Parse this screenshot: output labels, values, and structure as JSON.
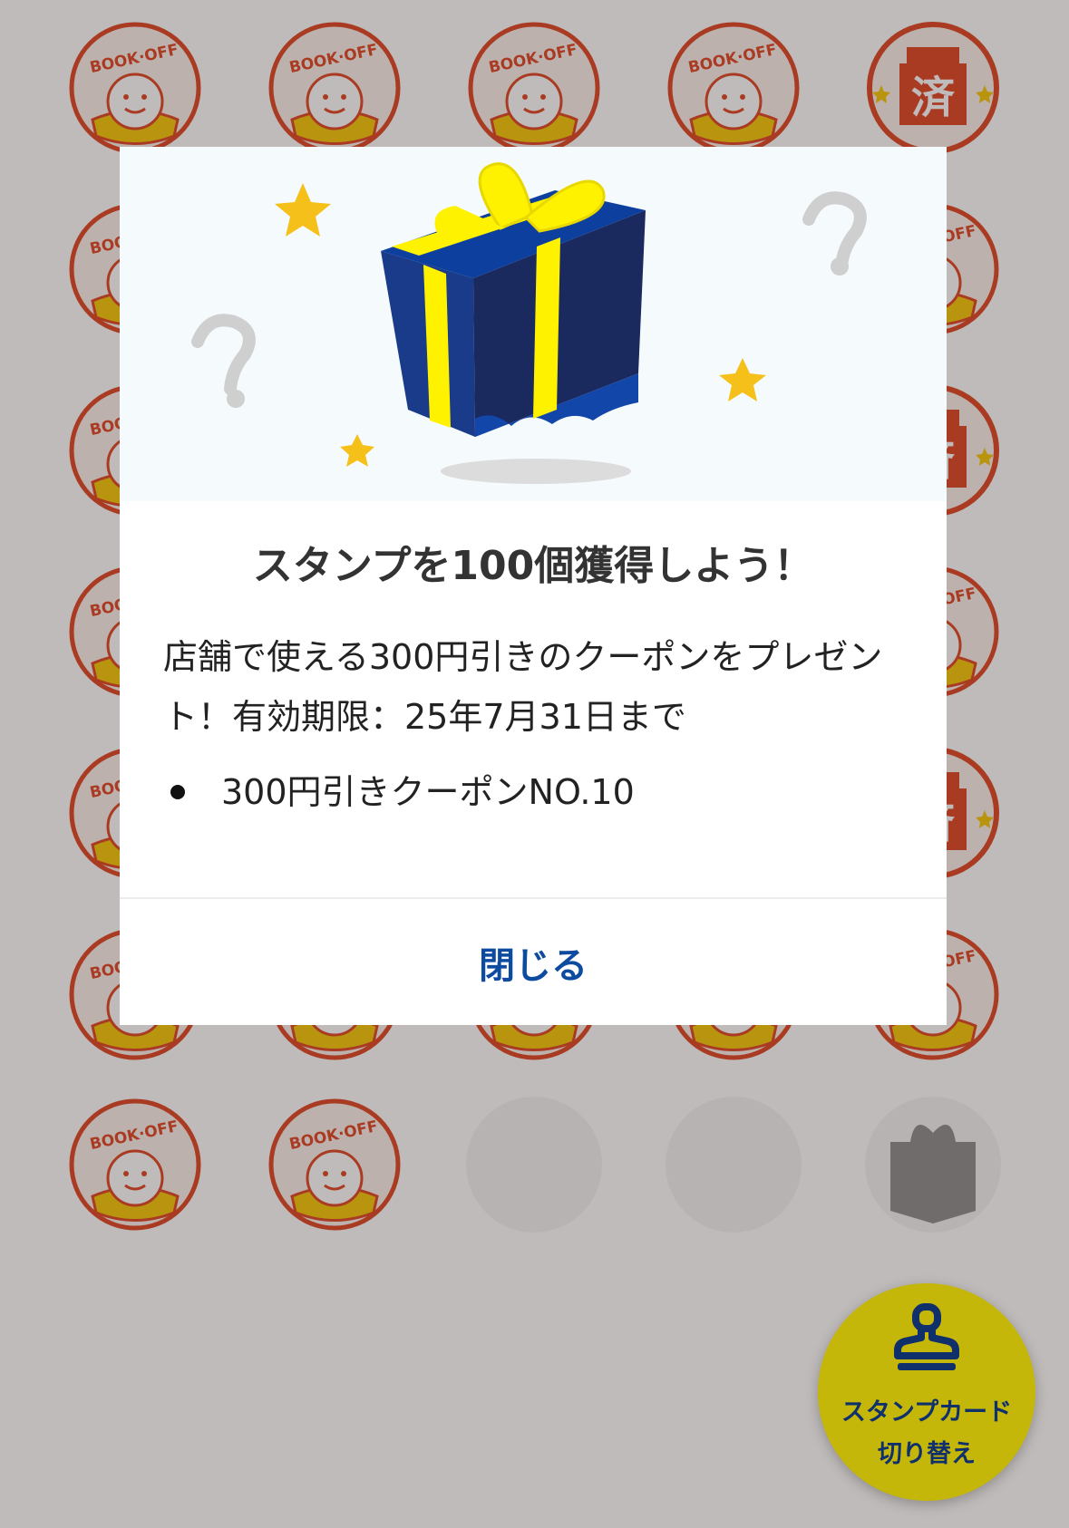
{
  "stamp_card": {
    "stamp_logo_text": "BOOK·OFF",
    "reward_stamp_char": "済",
    "stamp_states": [
      [
        "logo",
        "logo",
        "logo",
        "logo",
        "reward-used"
      ],
      [
        "logo",
        "logo",
        "logo",
        "logo",
        "logo"
      ],
      [
        "logo",
        "logo",
        "logo",
        "logo",
        "reward-used"
      ],
      [
        "logo",
        "logo",
        "logo",
        "logo",
        "logo"
      ],
      [
        "logo",
        "logo",
        "logo",
        "logo",
        "reward-used"
      ],
      [
        "logo",
        "logo",
        "logo",
        "logo",
        "logo"
      ],
      [
        "logo",
        "logo",
        "empty",
        "empty",
        "reward-pending"
      ]
    ]
  },
  "modal": {
    "title": "スタンプを100個獲得しよう！",
    "description": "店舗で使える300円引きのクーポンをプレゼント！有効期限：25年7月31日まで",
    "rewards": [
      "300円引きクーポンNO.10"
    ],
    "close_label": "閉じる",
    "hero_icons": [
      "gift-box-icon",
      "star-icon",
      "question-mark-icon"
    ]
  },
  "fab": {
    "label_line1": "スタンプカード",
    "label_line2": "切り替え",
    "icon": "stamp-icon"
  },
  "colors": {
    "stamp_red": "#e0411f",
    "stamp_yellow": "#f6c600",
    "gift_navy": "#1b2a5e",
    "gift_blue": "#0d3f9e",
    "ribbon_yellow": "#fff200",
    "close_text": "#0d4ba0",
    "fab_bg": "#c4b70a",
    "fab_text": "#10306b"
  }
}
